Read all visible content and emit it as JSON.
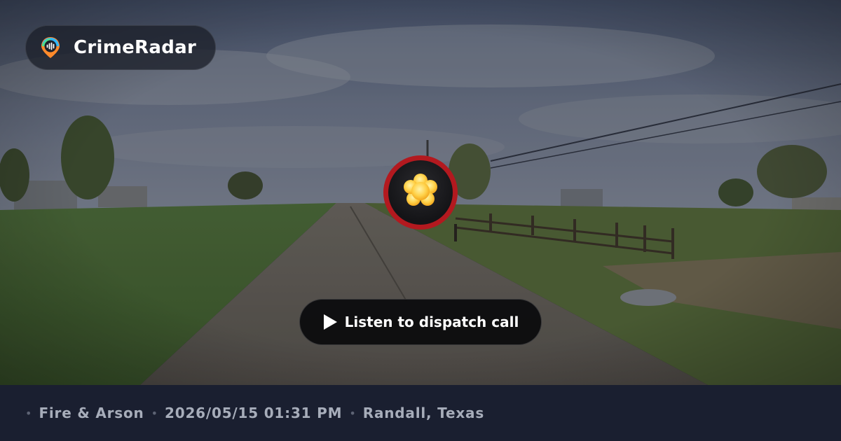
{
  "brand": {
    "name": "CrimeRadar",
    "logo_icon": "radar-pin-icon",
    "logo_colors": [
      "#2fb8ff",
      "#4ee08a",
      "#ff8a2b"
    ]
  },
  "incident": {
    "icon": "fire-arson-icon",
    "icon_color": "#ffd24a",
    "ring_color": "#b3191f"
  },
  "player": {
    "label": "Listen to dispatch call",
    "icon": "play-icon"
  },
  "footer": {
    "separator": "•",
    "category": "Fire & Arson",
    "datetime": "2026/05/15 01:31 PM",
    "location": "Randall, Texas"
  }
}
